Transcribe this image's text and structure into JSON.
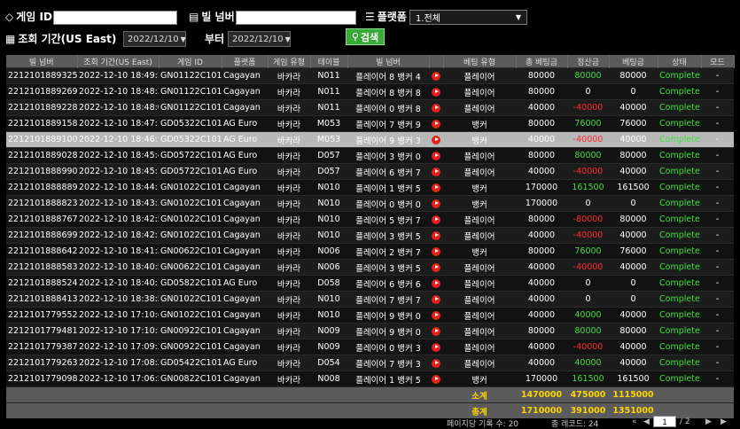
{
  "filters": {
    "game_id_label": "게임 ID",
    "bill_no_label": "빌 넘버",
    "platform_label": "플랫폼",
    "platform_value": "1.전체",
    "period_label": "조회 기간(US East)",
    "date_from": "2022/12/10",
    "from_suffix": "부터",
    "date_to": "2022/12/10",
    "search_label": "검색"
  },
  "table": {
    "headers": [
      "빌 넘버",
      "조회 기간(US East)",
      "게임 ID",
      "플랫폼",
      "게임 유형",
      "테이블",
      "빌 넘버",
      "",
      "베팅 유형",
      "총 베팅금",
      "정산금",
      "베팅금",
      "상태",
      "모드"
    ],
    "rows": [
      {
        "bill": "221210188932578",
        "date": "2022-12-10 18:49:12",
        "game": "GN01122C101FJ",
        "platform": "Cagayan",
        "type": "바카라",
        "table": "N011",
        "player": "플레이어 8 뱅커 4",
        "bet_type": "플레이어",
        "total": "80000",
        "settle": "80000",
        "settle_color": "green",
        "bet": "80000",
        "status": "Complete",
        "mode": "-"
      },
      {
        "bill": "221210188926981",
        "date": "2022-12-10 18:48:32",
        "game": "GN01122C101FI",
        "platform": "Cagayan",
        "type": "바카라",
        "table": "N011",
        "player": "플레이어 8 뱅커 8",
        "bet_type": "플레이어",
        "total": "80000",
        "settle": "0",
        "settle_color": "white",
        "bet": "0",
        "status": "Complete",
        "mode": "-"
      },
      {
        "bill": "221210188922817",
        "date": "2022-12-10 18:48:00",
        "game": "GN01122C101FH",
        "platform": "Cagayan",
        "type": "바카라",
        "table": "N011",
        "player": "플레이어 0 뱅커 8",
        "bet_type": "플레이어",
        "total": "40000",
        "settle": "-40000",
        "settle_color": "red",
        "bet": "40000",
        "status": "Complete",
        "mode": "-"
      },
      {
        "bill": "221210188915891",
        "date": "2022-12-10 18:47:16",
        "game": "GD05322C101F6",
        "platform": "AG Euro",
        "type": "바카라",
        "table": "M053",
        "player": "플레이어 7 뱅커 9",
        "bet_type": "뱅커",
        "total": "80000",
        "settle": "76000",
        "settle_color": "green",
        "bet": "76000",
        "status": "Complete",
        "mode": "-"
      },
      {
        "bill": "221210188910056",
        "date": "2022-12-10 18:46:37",
        "game": "GD05322C101F5",
        "platform": "AG Euro",
        "type": "바카라",
        "table": "M053",
        "player": "플레이어 9 뱅커 3",
        "bet_type": "뱅커",
        "total": "40000",
        "settle": "-40000",
        "settle_color": "red",
        "bet": "40000",
        "status": "Complete",
        "mode": "-"
      },
      {
        "bill": "221210188902890",
        "date": "2022-12-10 18:45:45",
        "game": "GD05722C101NO",
        "platform": "AG Euro",
        "type": "바카라",
        "table": "D057",
        "player": "플레이어 3 뱅커 0",
        "bet_type": "플레이어",
        "total": "80000",
        "settle": "80000",
        "settle_color": "green",
        "bet": "80000",
        "status": "Complete",
        "mode": "-"
      },
      {
        "bill": "221210188899001",
        "date": "2022-12-10 18:45:18",
        "game": "GD05722C101NN",
        "platform": "AG Euro",
        "type": "바카라",
        "table": "D057",
        "player": "플레이어 6 뱅커 7",
        "bet_type": "플레이어",
        "total": "40000",
        "settle": "-40000",
        "settle_color": "red",
        "bet": "40000",
        "status": "Complete",
        "mode": "-"
      },
      {
        "bill": "221210188888945",
        "date": "2022-12-10 18:44:12",
        "game": "GN01022C101G3",
        "platform": "Cagayan",
        "type": "바카라",
        "table": "N010",
        "player": "플레이어 1 뱅커 5",
        "bet_type": "뱅커",
        "total": "170000",
        "settle": "161500",
        "settle_color": "green",
        "bet": "161500",
        "status": "Complete",
        "mode": "-"
      },
      {
        "bill": "221210188882313",
        "date": "2022-12-10 18:43:30",
        "game": "GN01022C101G2",
        "platform": "Cagayan",
        "type": "바카라",
        "table": "N010",
        "player": "플레이어 0 뱅커 0",
        "bet_type": "뱅커",
        "total": "170000",
        "settle": "0",
        "settle_color": "white",
        "bet": "0",
        "status": "Complete",
        "mode": "-"
      },
      {
        "bill": "221210188876768",
        "date": "2022-12-10 18:42:54",
        "game": "GN01022C101G1",
        "platform": "Cagayan",
        "type": "바카라",
        "table": "N010",
        "player": "플레이어 5 뱅커 7",
        "bet_type": "플레이어",
        "total": "80000",
        "settle": "-80000",
        "settle_color": "red",
        "bet": "80000",
        "status": "Complete",
        "mode": "-"
      },
      {
        "bill": "221210188869945",
        "date": "2022-12-10 18:42:11",
        "game": "GN01022C101G0",
        "platform": "Cagayan",
        "type": "바카라",
        "table": "N010",
        "player": "플레이어 3 뱅커 5",
        "bet_type": "플레이어",
        "total": "40000",
        "settle": "-40000",
        "settle_color": "red",
        "bet": "40000",
        "status": "Complete",
        "mode": "-"
      },
      {
        "bill": "221210188864201",
        "date": "2022-12-10 18:41:34",
        "game": "GN00622C10134",
        "platform": "Cagayan",
        "type": "바카라",
        "table": "N006",
        "player": "플레이어 2 뱅커 7",
        "bet_type": "뱅커",
        "total": "80000",
        "settle": "76000",
        "settle_color": "green",
        "bet": "76000",
        "status": "Complete",
        "mode": "-"
      },
      {
        "bill": "221210188858391",
        "date": "2022-12-10 18:40:52",
        "game": "GN00622C10133",
        "platform": "Cagayan",
        "type": "바카라",
        "table": "N006",
        "player": "플레이어 3 뱅커 5",
        "bet_type": "플레이어",
        "total": "40000",
        "settle": "-40000",
        "settle_color": "red",
        "bet": "40000",
        "status": "Complete",
        "mode": "-"
      },
      {
        "bill": "221210188852455",
        "date": "2022-12-10 18:40:11",
        "game": "GD05822C101BA",
        "platform": "AG Euro",
        "type": "바카라",
        "table": "D058",
        "player": "플레이어 6 뱅커 6",
        "bet_type": "플레이어",
        "total": "40000",
        "settle": "0",
        "settle_color": "white",
        "bet": "0",
        "status": "Complete",
        "mode": "-"
      },
      {
        "bill": "221210188841398",
        "date": "2022-12-10 18:38:59",
        "game": "GN01022C101FU",
        "platform": "Cagayan",
        "type": "바카라",
        "table": "N010",
        "player": "플레이어 7 뱅커 7",
        "bet_type": "플레이어",
        "total": "40000",
        "settle": "0",
        "settle_color": "white",
        "bet": "0",
        "status": "Complete",
        "mode": "-"
      },
      {
        "bill": "221210177955266",
        "date": "2022-12-10 17:10:42",
        "game": "GN01022C101BK",
        "platform": "Cagayan",
        "type": "바카라",
        "table": "N010",
        "player": "플레이어 9 뱅커 0",
        "bet_type": "플레이어",
        "total": "40000",
        "settle": "40000",
        "settle_color": "green",
        "bet": "40000",
        "status": "Complete",
        "mode": "-"
      },
      {
        "bill": "221210177948169",
        "date": "2022-12-10 17:10:13",
        "game": "GN00922C1010A",
        "platform": "Cagayan",
        "type": "바카라",
        "table": "N009",
        "player": "플레이어 9 뱅커 0",
        "bet_type": "플레이어",
        "total": "80000",
        "settle": "80000",
        "settle_color": "green",
        "bet": "80000",
        "status": "Complete",
        "mode": "-"
      },
      {
        "bill": "221210177938760",
        "date": "2022-12-10 17:09:26",
        "game": "GN00922C10109",
        "platform": "Cagayan",
        "type": "바카라",
        "table": "N009",
        "player": "플레이어 0 뱅커 3",
        "bet_type": "플레이어",
        "total": "40000",
        "settle": "-40000",
        "settle_color": "red",
        "bet": "40000",
        "status": "Complete",
        "mode": "-"
      },
      {
        "bill": "221210177926302",
        "date": "2022-12-10 17:08:22",
        "game": "GD05422C101B4",
        "platform": "AG Euro",
        "type": "바카라",
        "table": "D054",
        "player": "플레이어 7 뱅커 3",
        "bet_type": "플레이어",
        "total": "40000",
        "settle": "40000",
        "settle_color": "green",
        "bet": "40000",
        "status": "Complete",
        "mode": "-"
      },
      {
        "bill": "221210177909875",
        "date": "2022-12-10 17:06:57",
        "game": "GN00822C10113",
        "platform": "Cagayan",
        "type": "바카라",
        "table": "N008",
        "player": "플레이어 1 뱅커 5",
        "bet_type": "뱅커",
        "total": "170000",
        "settle": "161500",
        "settle_color": "green",
        "bet": "161500",
        "status": "Complete",
        "mode": "-"
      }
    ],
    "subtotal": {
      "label": "소계",
      "total": "1470000",
      "settle": "475000",
      "bet": "1115000"
    },
    "grandtotal": {
      "label": "총계",
      "total": "1710000",
      "settle": "391000",
      "bet": "1351000"
    }
  },
  "footer": {
    "per_page_label": "페이지당 기록 수: 20",
    "total_records_label": "총 레코드: 24",
    "page_input": "1",
    "page_total": "/  2",
    "nav_first": "«",
    "nav_prev": "◀",
    "nav_next": "▶",
    "nav_last": "▶"
  }
}
